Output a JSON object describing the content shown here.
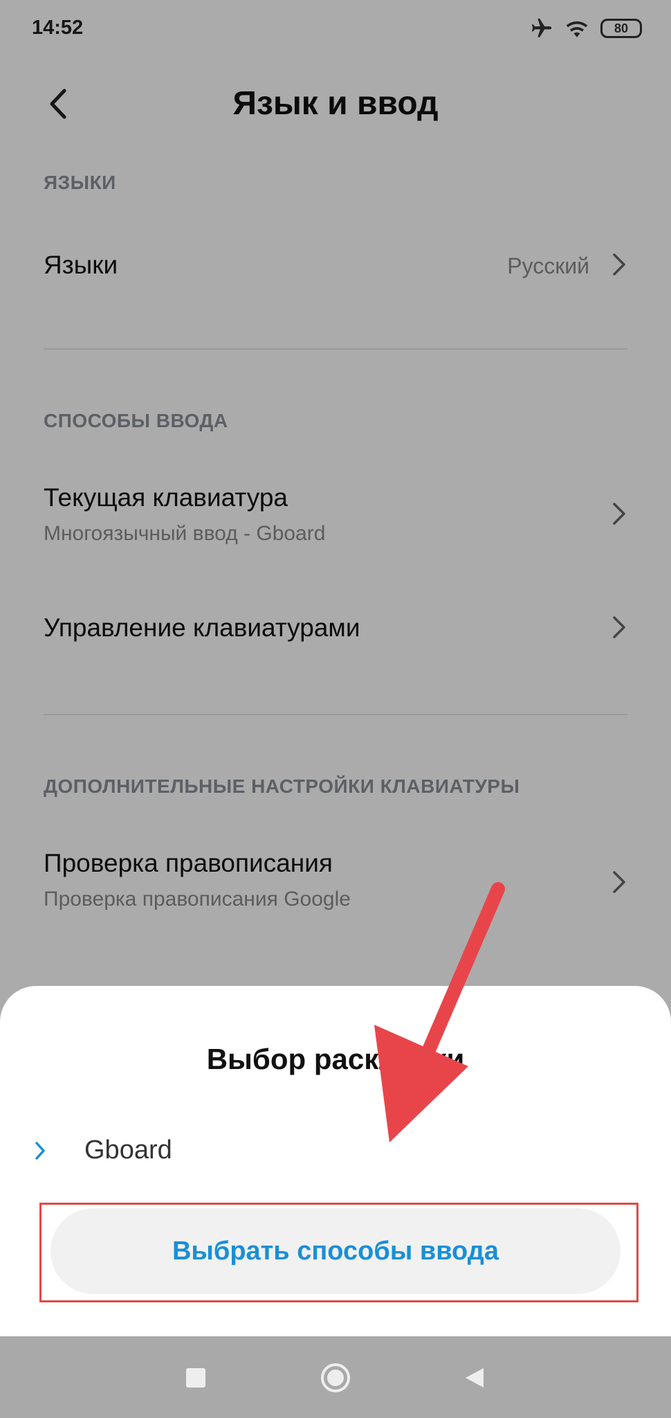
{
  "status_bar": {
    "time": "14:52",
    "battery": "80",
    "icons": [
      "airplane-icon",
      "wifi-icon",
      "battery-icon"
    ]
  },
  "header": {
    "title": "Язык и ввод",
    "back_icon": "chevron-left-icon"
  },
  "sections": {
    "languages": {
      "header": "ЯЗЫКИ",
      "items": [
        {
          "title": "Языки",
          "value": "Русский"
        }
      ]
    },
    "input_methods": {
      "header": "СПОСОБЫ ВВОДА",
      "items": [
        {
          "title": "Текущая клавиатура",
          "subtitle": "Многоязычный ввод - Gboard"
        },
        {
          "title": "Управление клавиатурами"
        }
      ]
    },
    "advanced": {
      "header": "ДОПОЛНИТЕЛЬНЫЕ НАСТРОЙКИ КЛАВИАТУРЫ",
      "items": [
        {
          "title": "Проверка правописания",
          "subtitle": "Проверка правописания Google"
        }
      ]
    }
  },
  "sheet": {
    "title": "Выбор раскладки",
    "items": [
      {
        "label": "Gboard"
      }
    ],
    "button_label": "Выбрать способы ввода"
  },
  "navbar": {
    "icons": [
      "recents-square-icon",
      "home-circle-icon",
      "back-triangle-icon"
    ]
  },
  "colors": {
    "accent": "#1a8fd6",
    "highlight": "#e04a4a",
    "arrow": "#e8454b",
    "scrim": "rgba(0,0,0,0.33)",
    "navbar": "#a9a9a9"
  }
}
